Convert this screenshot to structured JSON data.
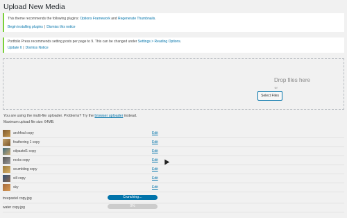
{
  "page": {
    "title": "Upload New Media"
  },
  "notices": {
    "plugins": {
      "text_before": "This theme recommends the following plugins: ",
      "plugin1": "Options Framework",
      "and": " and ",
      "plugin2": "Regenerate Thumbnails",
      "text_after": ".",
      "link_install": "Begin installing plugins",
      "sep": "|",
      "link_dismiss": "Dismiss this notice"
    },
    "portfolio": {
      "text_before": "Portfolio Press recommends setting posts per page to 9. This can be changed under ",
      "link_settings": "Settings > Reading Options",
      "text_after": ".",
      "link_update": "Update It",
      "sep": "|",
      "link_dismiss": "Dismiss Notice"
    }
  },
  "dropzone": {
    "drop_text": "Drop files here",
    "or_text": "or",
    "select_files": "Select Files"
  },
  "uploader_info": {
    "text_before": "You are using the multi-file uploader. Problems? Try the ",
    "link_browser": "browser uploader",
    "text_after": " instead.",
    "max_size": "Maximum upload file size: 64MB."
  },
  "media_items": [
    {
      "name": "archfoal copy",
      "edit": "Edit"
    },
    {
      "name": "feathering 1 copy",
      "edit": "Edit"
    },
    {
      "name": "oilpastel1 copy",
      "edit": "Edit"
    },
    {
      "name": "rocks copy",
      "edit": "Edit"
    },
    {
      "name": "scumbling copy",
      "edit": "Edit"
    },
    {
      "name": "sill copy",
      "edit": "Edit"
    },
    {
      "name": "sky",
      "edit": "Edit"
    }
  ],
  "uploading_items": [
    {
      "name": "treepastel copy.jpg",
      "progress_label": "Crunching…",
      "status": "active"
    },
    {
      "name": "water copy.jpg",
      "progress_label": "0%",
      "status": "idle"
    }
  ],
  "icons": {
    "cursor": "mouse-pointer-icon"
  }
}
